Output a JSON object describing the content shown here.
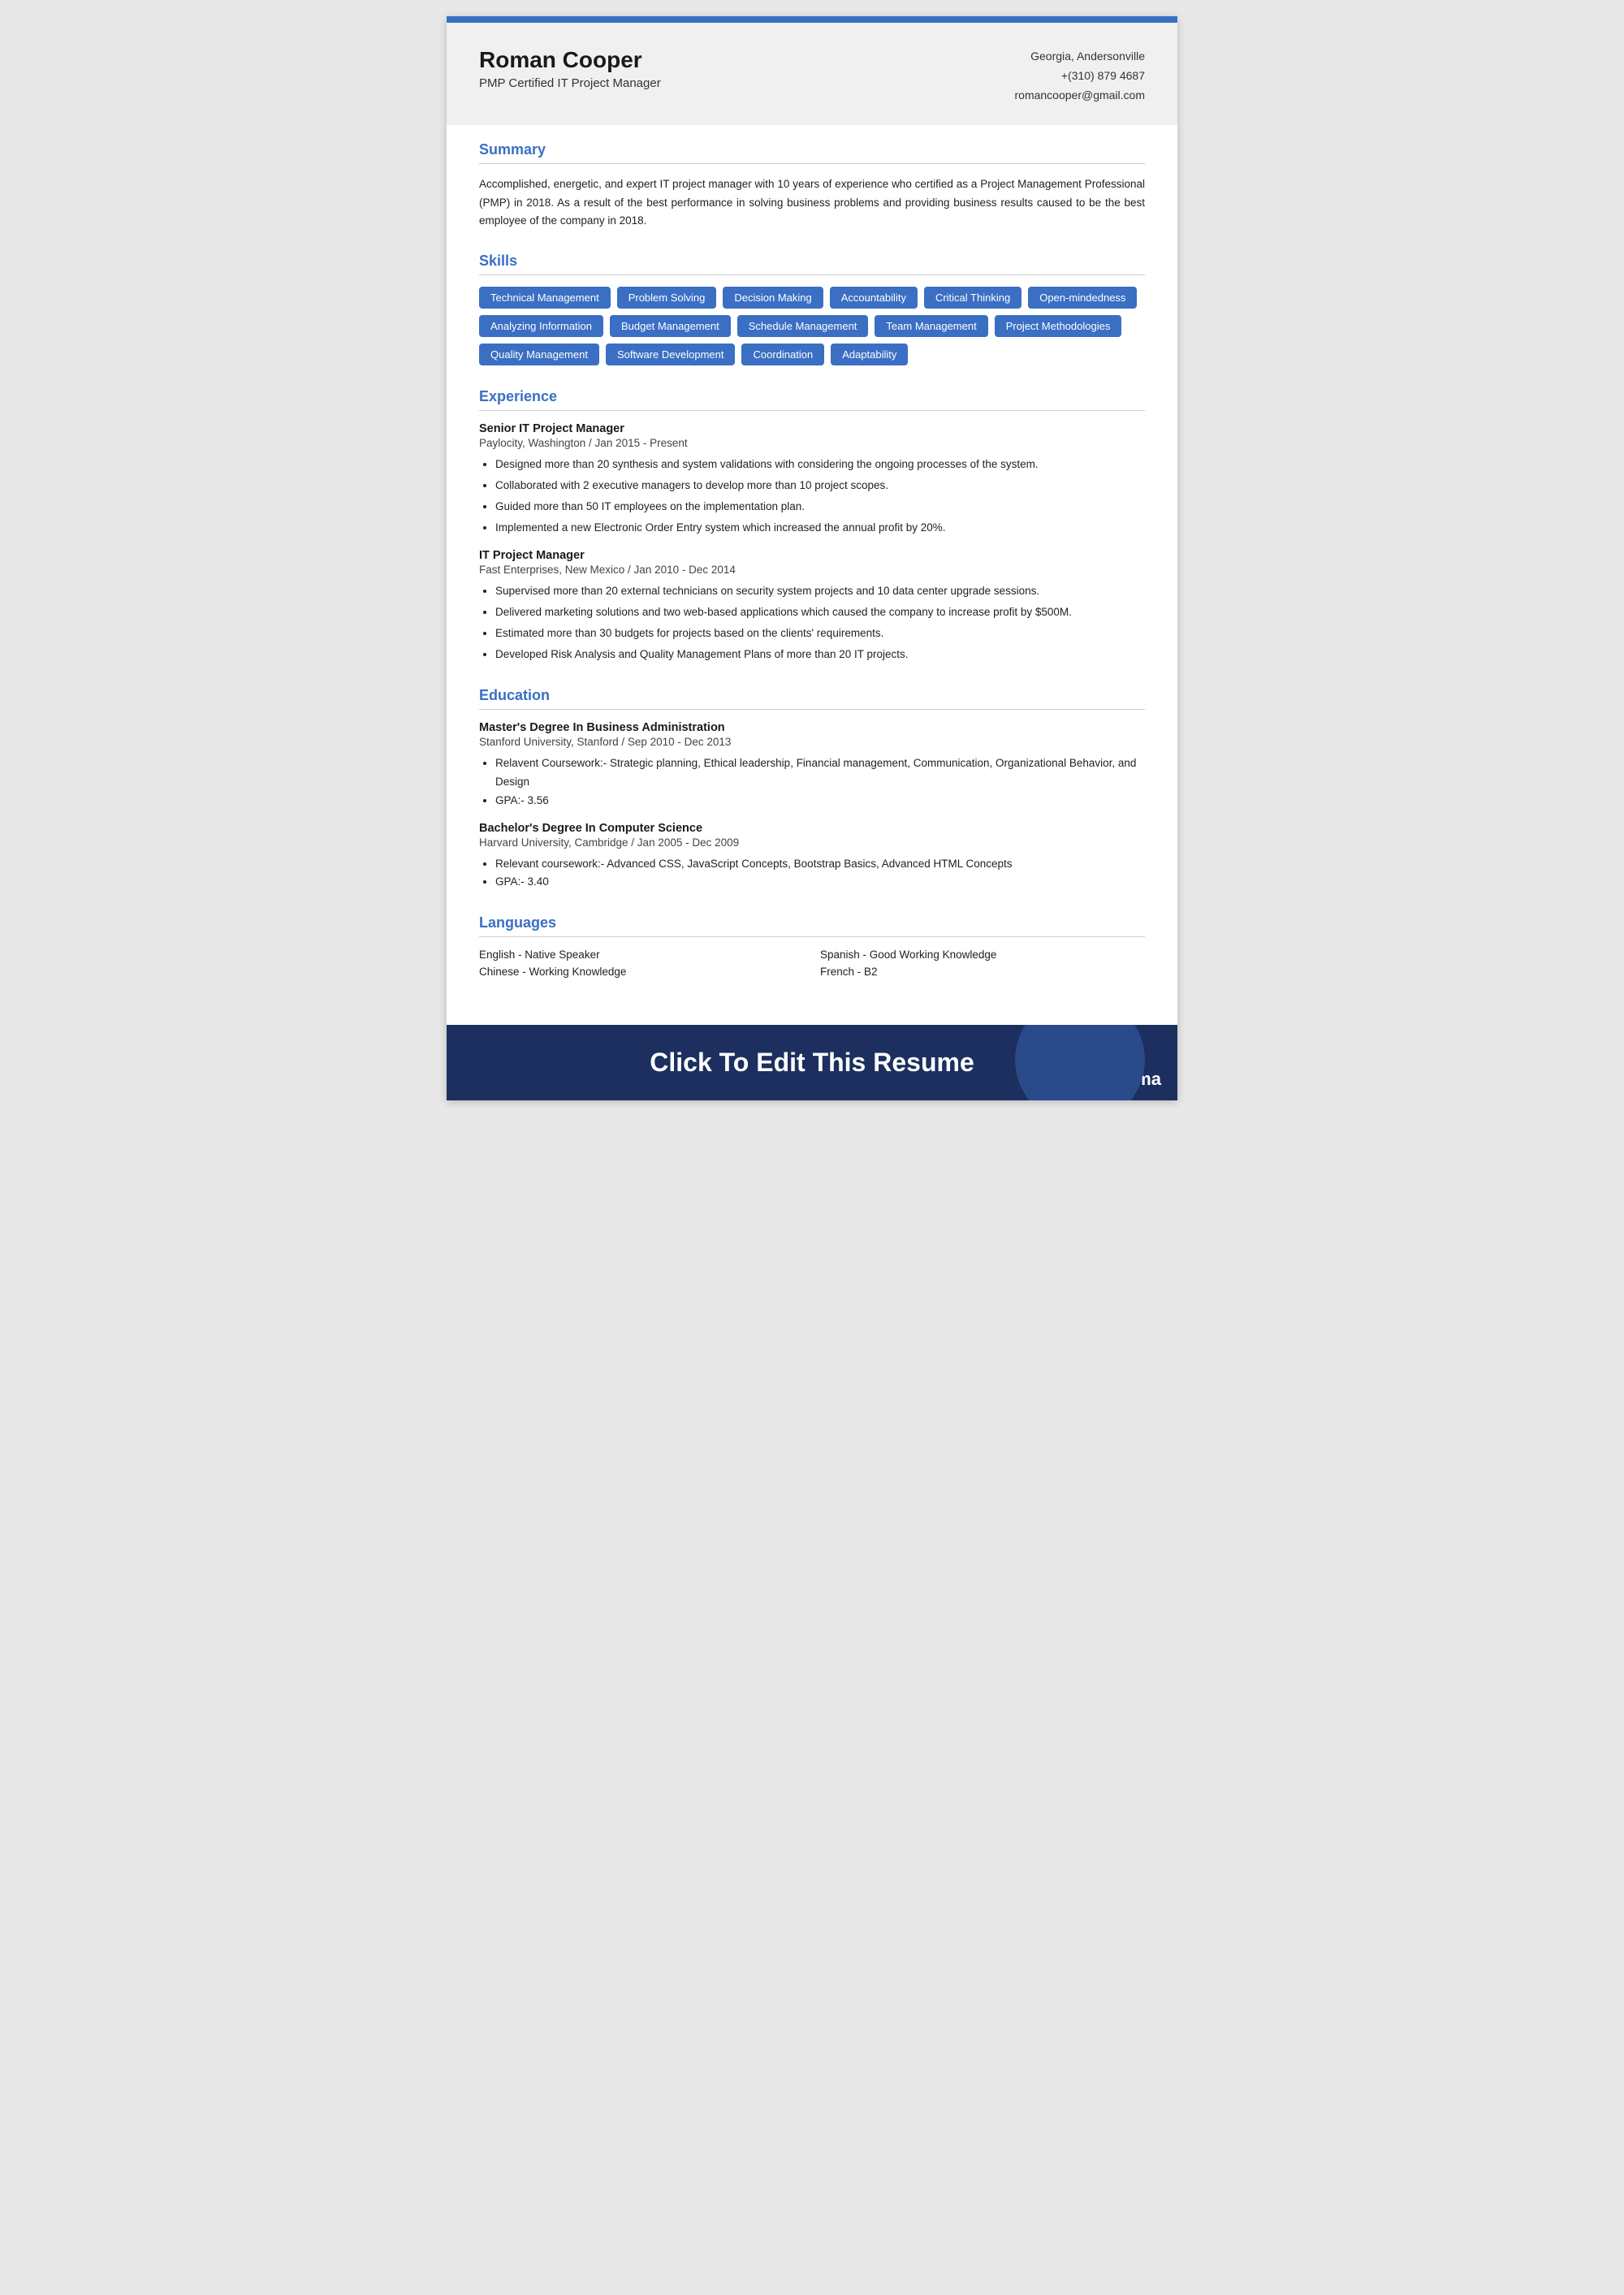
{
  "header": {
    "name": "Roman Cooper",
    "title": "PMP Certified IT Project Manager",
    "location": "Georgia, Andersonville",
    "phone": "+(310) 879 4687",
    "email": "romancooper@gmail.com"
  },
  "summary": {
    "section_title": "Summary",
    "text": "Accomplished, energetic, and expert IT project manager with 10 years of experience who certified as a Project Management Professional (PMP) in 2018. As a result of the best performance in solving business problems and providing business results caused to be the best employee of the company in 2018."
  },
  "skills": {
    "section_title": "Skills",
    "items": [
      "Technical Management",
      "Problem Solving",
      "Decision Making",
      "Accountability",
      "Critical Thinking",
      "Open-mindedness",
      "Analyzing Information",
      "Budget Management",
      "Schedule Management",
      "Team Management",
      "Project Methodologies",
      "Quality Management",
      "Software Development",
      "Coordination",
      "Adaptability"
    ]
  },
  "experience": {
    "section_title": "Experience",
    "jobs": [
      {
        "title": "Senior IT Project Manager",
        "company": "Paylocity, Washington / Jan 2015 - Present",
        "bullets": [
          "Designed more than 20 synthesis and system validations with considering the ongoing processes of the system.",
          "Collaborated with 2 executive managers to develop more than 10 project scopes.",
          "Guided more than 50 IT employees on the implementation plan.",
          "Implemented a new Electronic Order Entry system which increased the annual profit by 20%."
        ]
      },
      {
        "title": "IT Project Manager",
        "company": "Fast Enterprises, New Mexico / Jan 2010 - Dec 2014",
        "bullets": [
          "Supervised more than 20 external technicians on security system projects and 10 data center upgrade sessions.",
          "Delivered marketing solutions and two web-based applications which caused the company to increase profit by $500M.",
          "Estimated more than 30 budgets for projects based on the clients' requirements.",
          "Developed Risk Analysis and Quality Management Plans of more than 20 IT projects."
        ]
      }
    ]
  },
  "education": {
    "section_title": "Education",
    "degrees": [
      {
        "title": "Master's Degree In Business Administration",
        "institution": "Stanford University, Stanford / Sep 2010 - Dec 2013",
        "bullets": [
          "Relavent Coursework:- Strategic planning, Ethical leadership, Financial management, Communication, Organizational Behavior, and Design",
          "GPA:- 3.56"
        ]
      },
      {
        "title": "Bachelor's Degree In Computer Science",
        "institution": "Harvard University, Cambridge / Jan 2005 - Dec 2009",
        "bullets": [
          "Relevant coursework:- Advanced CSS, JavaScript Concepts,  Bootstrap Basics, Advanced HTML Concepts",
          "GPA:- 3.40"
        ]
      }
    ]
  },
  "languages": {
    "section_title": "Languages",
    "items": [
      {
        "label": "English - Native Speaker",
        "col": 1
      },
      {
        "label": "Spanish - Good Working Knowledge",
        "col": 2
      },
      {
        "label": "Chinese - Working Knowledge",
        "col": 1
      },
      {
        "label": "French - B2",
        "col": 2
      }
    ]
  },
  "footer": {
    "cta": "Click To Edit This Resume",
    "logo_text": "esuma",
    "logo_icon": "Cr"
  }
}
